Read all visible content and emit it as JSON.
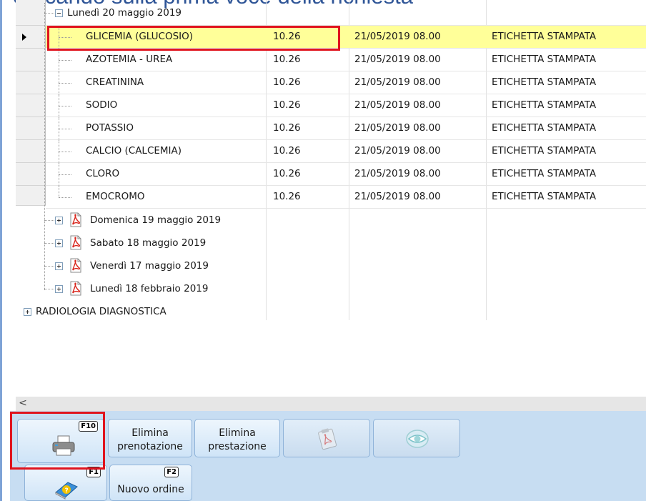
{
  "caption": "cliccando sulla prima voce della richiesta",
  "tree": {
    "date_node_label": "Lunedì 20 maggio 2019",
    "rows": [
      {
        "name": "GLICEMIA (GLUCOSIO)",
        "time": "10.26",
        "datetime": "21/05/2019 08.00",
        "status": "ETICHETTA STAMPATA"
      },
      {
        "name": "AZOTEMIA - UREA",
        "time": "10.26",
        "datetime": "21/05/2019 08.00",
        "status": "ETICHETTA STAMPATA"
      },
      {
        "name": "CREATININA",
        "time": "10.26",
        "datetime": "21/05/2019 08.00",
        "status": "ETICHETTA STAMPATA"
      },
      {
        "name": "SODIO",
        "time": "10.26",
        "datetime": "21/05/2019 08.00",
        "status": "ETICHETTA STAMPATA"
      },
      {
        "name": "POTASSIO",
        "time": "10.26",
        "datetime": "21/05/2019 08.00",
        "status": "ETICHETTA STAMPATA"
      },
      {
        "name": "CALCIO (CALCEMIA)",
        "time": "10.26",
        "datetime": "21/05/2019 08.00",
        "status": "ETICHETTA STAMPATA"
      },
      {
        "name": "CLORO",
        "time": "10.26",
        "datetime": "21/05/2019 08.00",
        "status": "ETICHETTA STAMPATA"
      },
      {
        "name": "EMOCROMO",
        "time": "10.26",
        "datetime": "21/05/2019 08.00",
        "status": "ETICHETTA STAMPATA"
      }
    ],
    "collapsed_dates": [
      "Domenica 19 maggio 2019",
      "Sabato 18 maggio 2019",
      "Venerdì 17 maggio 2019",
      "Lunedì 18 febbraio 2019"
    ],
    "category_node_label": "RADIOLOGIA DIAGNOSTICA"
  },
  "scrollbar": {
    "left_arrow": "<"
  },
  "toolbar": {
    "print_fkey": "F10",
    "elimina_prenotazione_line1": "Elimina",
    "elimina_prenotazione_line2": "prenotazione",
    "elimina_prestazione_line1": "Elimina",
    "elimina_prestazione_line2": "prestazione",
    "help_fkey": "F1",
    "nuovo_ordine_fkey": "F2",
    "nuovo_ordine_label": "Nuovo ordine"
  },
  "colors": {
    "selection": "#ffff99",
    "highlight_border": "#e0141e",
    "toolbar_bg": "#c7ddf2",
    "caption": "#2f5597"
  }
}
